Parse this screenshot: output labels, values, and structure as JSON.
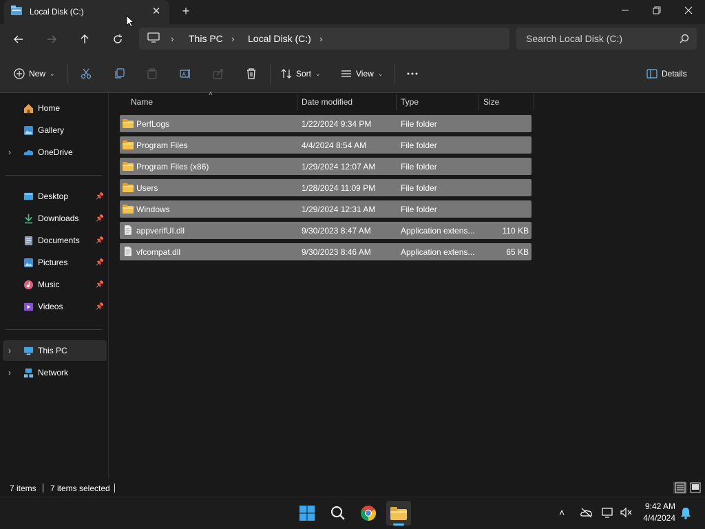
{
  "window": {
    "tab_title": "Local Disk (C:)"
  },
  "address": {
    "crumbs": [
      "This PC",
      "Local Disk (C:)"
    ],
    "search_placeholder": "Search Local Disk (C:)"
  },
  "toolbar": {
    "new_label": "New",
    "sort_label": "Sort",
    "view_label": "View",
    "details_label": "Details"
  },
  "sidebar": {
    "items": [
      {
        "label": "Home",
        "icon": "home-icon"
      },
      {
        "label": "Gallery",
        "icon": "gallery-icon"
      },
      {
        "label": "OneDrive",
        "icon": "onedrive-icon"
      },
      {
        "label": "Desktop",
        "icon": "desktop-icon"
      },
      {
        "label": "Downloads",
        "icon": "downloads-icon"
      },
      {
        "label": "Documents",
        "icon": "documents-icon"
      },
      {
        "label": "Pictures",
        "icon": "pictures-icon"
      },
      {
        "label": "Music",
        "icon": "music-icon"
      },
      {
        "label": "Videos",
        "icon": "videos-icon"
      },
      {
        "label": "This PC",
        "icon": "this-pc-icon"
      },
      {
        "label": "Network",
        "icon": "network-icon"
      }
    ]
  },
  "files": {
    "columns": [
      "Name",
      "Date modified",
      "Type",
      "Size"
    ],
    "rows": [
      {
        "name": "PerfLogs",
        "date": "1/22/2024 9:34 PM",
        "type": "File folder",
        "size": "",
        "kind": "folder"
      },
      {
        "name": "Program Files",
        "date": "4/4/2024 8:54 AM",
        "type": "File folder",
        "size": "",
        "kind": "folder"
      },
      {
        "name": "Program Files (x86)",
        "date": "1/29/2024 12:07 AM",
        "type": "File folder",
        "size": "",
        "kind": "folder"
      },
      {
        "name": "Users",
        "date": "1/28/2024 11:09 PM",
        "type": "File folder",
        "size": "",
        "kind": "folder"
      },
      {
        "name": "Windows",
        "date": "1/29/2024 12:31 AM",
        "type": "File folder",
        "size": "",
        "kind": "folder"
      },
      {
        "name": "appverifUI.dll",
        "date": "9/30/2023 8:47 AM",
        "type": "Application extens...",
        "size": "110 KB",
        "kind": "file"
      },
      {
        "name": "vfcompat.dll",
        "date": "9/30/2023 8:46 AM",
        "type": "Application extens...",
        "size": "65 KB",
        "kind": "file"
      }
    ]
  },
  "status": {
    "items_count": "7 items",
    "selected_count": "7 items selected"
  },
  "taskbar": {
    "time": "9:42 AM",
    "date": "4/4/2024"
  },
  "colors": {
    "selection": "#777777",
    "folder": "#f2c14e",
    "accent": "#4cc2ff"
  }
}
